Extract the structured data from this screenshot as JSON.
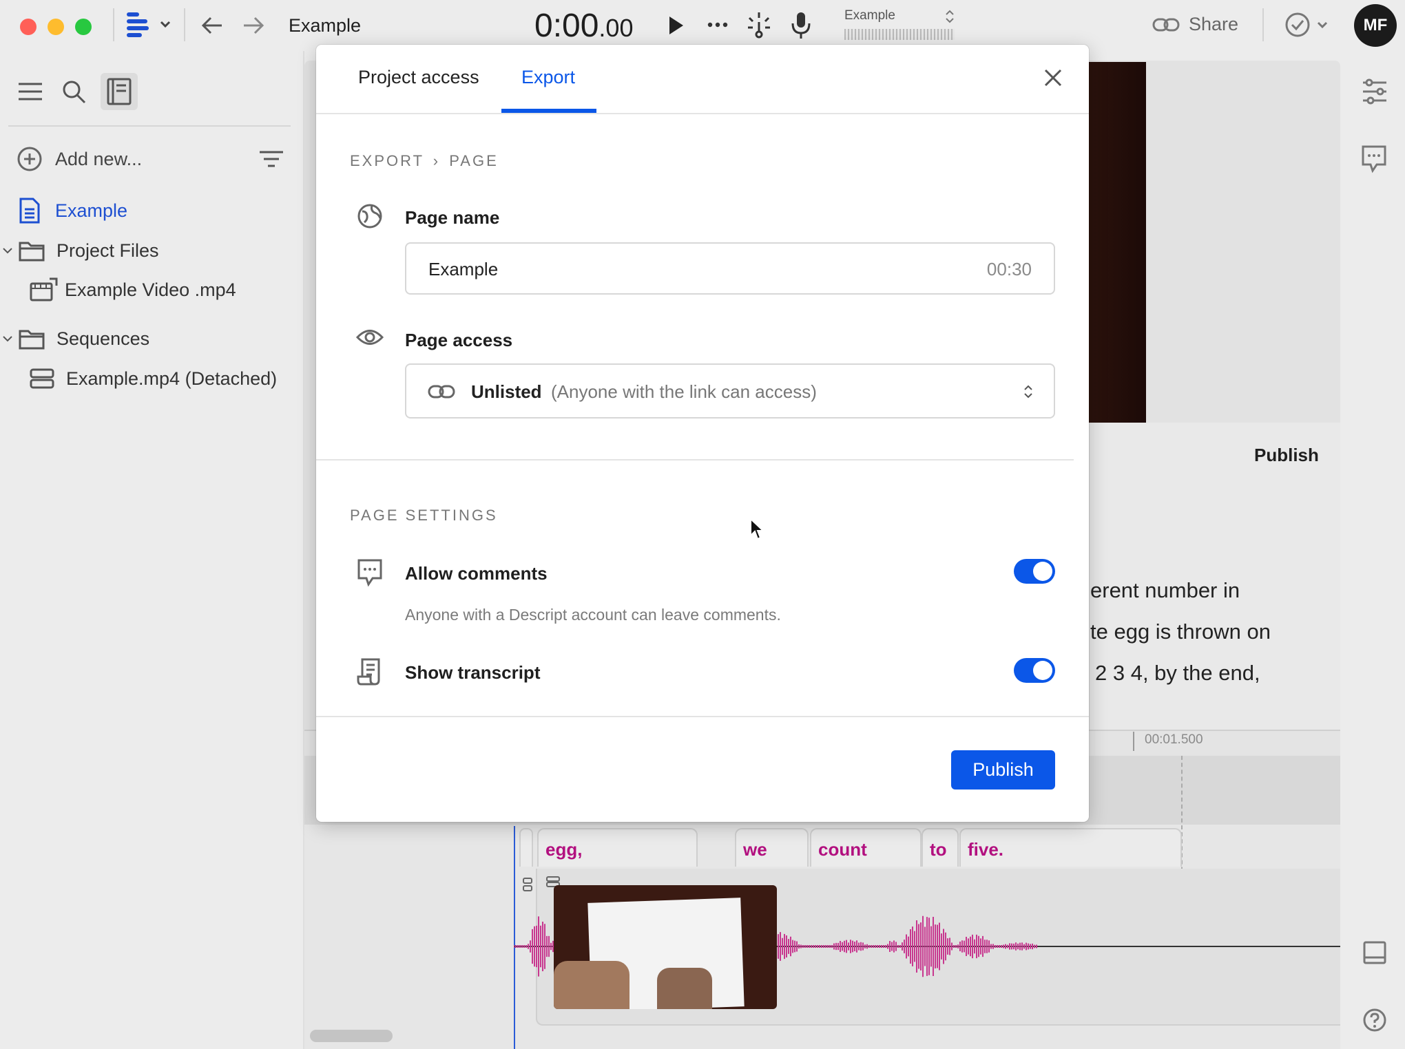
{
  "topbar": {
    "project_title": "Example",
    "timecode_main": "0:00",
    "timecode_frac": ".00",
    "scene_label": "Example",
    "share_label": "Share",
    "avatar_initials": "MF"
  },
  "sidebar": {
    "add_new_label": "Add new...",
    "items": [
      {
        "label": "Example"
      },
      {
        "label": "Project Files"
      },
      {
        "label": "Example Video .mp4"
      },
      {
        "label": "Sequences"
      },
      {
        "label": "Example.mp4 (Detached)"
      }
    ]
  },
  "background": {
    "publish_label": "Publish",
    "transcript_lines": [
      "erent number in",
      "te egg is thrown on",
      "2 3 4, by the end,"
    ],
    "ruler_time": "00:01.500",
    "words": [
      "egg,",
      "we",
      "count",
      "to",
      "five."
    ]
  },
  "modal": {
    "tabs": [
      {
        "label": "Project access"
      },
      {
        "label": "Export"
      }
    ],
    "active_tab": "Export",
    "breadcrumb": {
      "root": "EXPORT",
      "sep": "›",
      "leaf": "PAGE"
    },
    "page_name": {
      "label": "Page name",
      "value": "Example",
      "duration": "00:30"
    },
    "page_access": {
      "label": "Page access",
      "value": "Unlisted",
      "hint": "(Anyone with the link can access)"
    },
    "page_settings": {
      "heading": "PAGE SETTINGS",
      "allow_comments": {
        "label": "Allow comments",
        "description": "Anyone with a Descript account can leave comments.",
        "enabled": true
      },
      "show_transcript": {
        "label": "Show transcript",
        "enabled": true
      }
    },
    "publish_label": "Publish"
  },
  "colors": {
    "accent": "#0b57e8",
    "word_text": "#b2107f",
    "waveform": "#c8378f"
  }
}
